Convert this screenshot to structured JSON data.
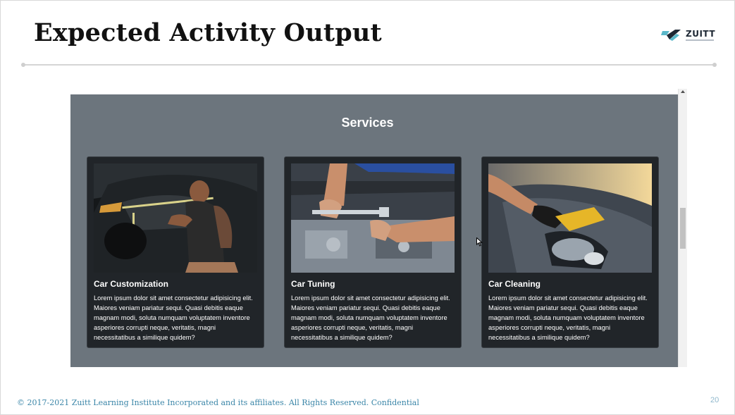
{
  "slide": {
    "title": "Expected Activity Output",
    "logo_text": "ZUITT",
    "footer": "© 2017-2021 Zuitt Learning Institute Incorporated and its affiliates. All Rights Reserved. Confidential",
    "page_number": "20"
  },
  "demo": {
    "section_title": "Services",
    "cards": [
      {
        "title": "Car Customization",
        "text": "Lorem ipsum dolor sit amet consectetur adipisicing elit. Maiores veniam pariatur sequi. Quasi debitis eaque magnam modi, soluta numquam voluptatem inventore asperiores corrupti neque, veritatis, magni necessitatibus a similique quidem?",
        "image": "mechanic-customizing-car-photo"
      },
      {
        "title": "Car Tuning",
        "text": "Lorem ipsum dolor sit amet consectetur adipisicing elit. Maiores veniam pariatur sequi. Quasi debitis eaque magnam modi, soluta numquam voluptatem inventore asperiores corrupti neque, veritatis, magni necessitatibus a similique quidem?",
        "image": "engine-wrench-tuning-photo"
      },
      {
        "title": "Car Cleaning",
        "text": "Lorem ipsum dolor sit amet consectetur adipisicing elit. Maiores veniam pariatur sequi. Quasi debitis eaque magnam modi, soluta numquam voluptatem inventore asperiores corrupti neque, veritatis, magni necessitatibus a similique quidem?",
        "image": "gloved-hand-cleaning-headlight-photo"
      }
    ]
  },
  "colors": {
    "demo_background": "#6c757d",
    "card_background": "#212529",
    "footer_text": "#3b86a8"
  }
}
